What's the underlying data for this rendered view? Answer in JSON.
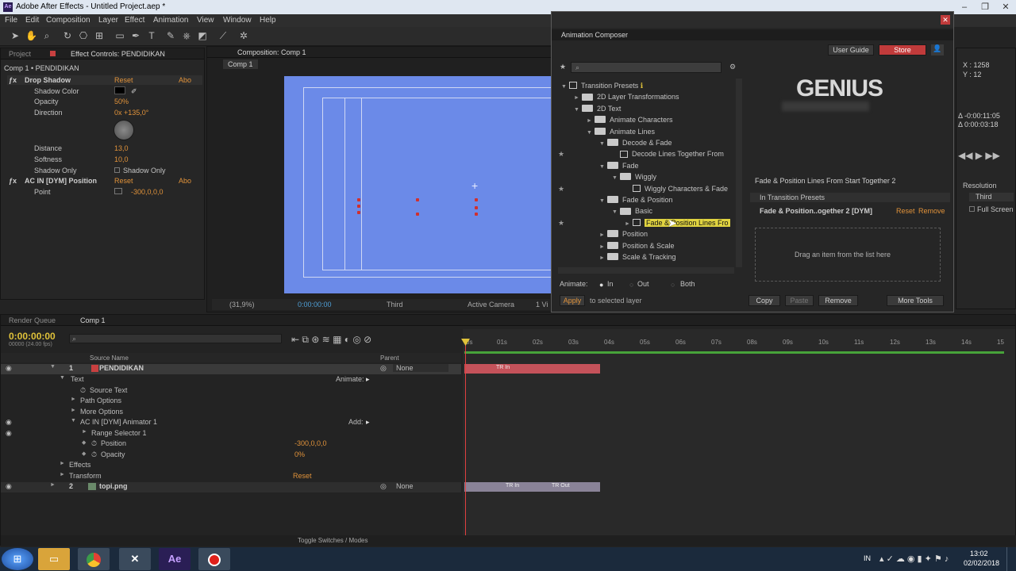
{
  "window": {
    "title": "Adobe After Effects - Untitled Project.aep *",
    "app_icon": "Ae"
  },
  "menu": [
    "File",
    "Edit",
    "Composition",
    "Layer",
    "Effect",
    "Animation",
    "View",
    "Window",
    "Help"
  ],
  "left_panel": {
    "tab_project": "Project",
    "tab_effect": "Effect Controls: PENDIDIKAN",
    "crumb": "Comp 1 • PENDIDIKAN",
    "fx1_name": "Drop Shadow",
    "reset": "Reset",
    "about": "Abo",
    "shadow_color": "Shadow Color",
    "opacity": "Opacity",
    "opacity_val": "50%",
    "direction": "Direction",
    "direction_val": "0x +135,0°",
    "distance": "Distance",
    "distance_val": "13,0",
    "softness": "Softness",
    "softness_val": "10,0",
    "shadow_only": "Shadow Only",
    "shadow_only_cb": "Shadow Only",
    "fx2_name": "AC IN [DYM] Position",
    "point": "Point",
    "point_val": "-300,0,0,0"
  },
  "comp_panel": {
    "tab": "Composition: Comp 1",
    "sub_tab": "Comp 1",
    "zoom": "(31,9%)",
    "timecode": "0:00:00:00",
    "view": "Third",
    "camera": "Active Camera",
    "views": "1 Vi"
  },
  "animation_composer": {
    "tab": "Animation Composer",
    "user_guide": "User Guide",
    "store": "Store",
    "logo": "GENIUS",
    "tree": [
      {
        "label": "Transition Presets",
        "depth": 0,
        "type": "root",
        "star": false
      },
      {
        "label": "2D Layer Transformations",
        "depth": 1,
        "type": "folder",
        "arrow": "►",
        "star": false
      },
      {
        "label": "2D Text",
        "depth": 1,
        "type": "folder",
        "arrow": "▼",
        "star": false
      },
      {
        "label": "Animate Characters",
        "depth": 2,
        "type": "folder",
        "arrow": "►",
        "star": false
      },
      {
        "label": "Animate Lines",
        "depth": 2,
        "type": "folder",
        "arrow": "▼",
        "star": false
      },
      {
        "label": "Decode & Fade",
        "depth": 3,
        "type": "folder",
        "arrow": "▼",
        "star": false
      },
      {
        "label": "Decode Lines Together From",
        "depth": 4,
        "type": "file",
        "arrow": "",
        "star": true
      },
      {
        "label": "Fade",
        "depth": 3,
        "type": "folder",
        "arrow": "▼",
        "star": false
      },
      {
        "label": "Wiggly",
        "depth": 4,
        "type": "folder",
        "arrow": "▼",
        "star": false
      },
      {
        "label": "Wiggly Characters & Fade",
        "depth": 5,
        "type": "file",
        "arrow": "",
        "star": true
      },
      {
        "label": "Fade & Position",
        "depth": 3,
        "type": "folder",
        "arrow": "▼",
        "star": false
      },
      {
        "label": "Basic",
        "depth": 4,
        "type": "folder",
        "arrow": "▼",
        "star": false
      },
      {
        "label": "Fade & Position Lines Fro",
        "depth": 5,
        "type": "file",
        "arrow": "►",
        "star": true,
        "selected": true
      },
      {
        "label": "Position",
        "depth": 3,
        "type": "folder",
        "arrow": "►",
        "star": false
      },
      {
        "label": "Position & Scale",
        "depth": 3,
        "type": "folder",
        "arrow": "►",
        "star": false
      },
      {
        "label": "Scale & Tracking",
        "depth": 3,
        "type": "folder",
        "arrow": "►",
        "star": false
      }
    ],
    "animate_label": "Animate:",
    "opt_in": "In",
    "opt_out": "Out",
    "opt_both": "Both",
    "apply": "Apply",
    "apply_hint": "to selected layer",
    "preset_title": "Fade & Position Lines From Start Together 2",
    "in_transition": "In Transition Presets",
    "applied_item": "Fade & Position..ogether 2 [DYM]",
    "reset": "Reset",
    "remove": "Remove",
    "drop_hint": "Drag an item from the list here",
    "copy": "Copy",
    "paste": "Paste",
    "remove_dd": "Remove",
    "more_tools": "More Tools"
  },
  "info_panel": {
    "x": "X : 1258",
    "y": "Y : 12",
    "t1": "Δ -0:00:11:05",
    "t2": "Δ 0:00:03:18",
    "resolution": "Resolution",
    "third": "Third",
    "full_screen": "Full Screen"
  },
  "timeline": {
    "tab_render": "Render Queue",
    "tab_comp": "Comp 1",
    "timecode": "0:00:00:00",
    "fps": "00000 (24.00 fps)",
    "col_source": "Source Name",
    "col_parent": "Parent",
    "ruler": [
      "0s",
      "01s",
      "02s",
      "03s",
      "04s",
      "05s",
      "06s",
      "07s",
      "08s",
      "09s",
      "10s",
      "11s",
      "12s",
      "13s",
      "14s",
      "15"
    ],
    "layer1_num": "1",
    "layer1_name": "PENDIDIKAN",
    "parent_none": "None",
    "text": "Text",
    "animate": "Animate:",
    "source_text": "Source Text",
    "path_options": "Path Options",
    "more_options": "More Options",
    "animator": "AC IN [DYM] Animator 1",
    "add": "Add:",
    "range_selector": "Range Selector 1",
    "position": "Position",
    "position_val": "-300,0,0,0",
    "opacity": "Opacity",
    "opacity_val": "0%",
    "effects": "Effects",
    "transform": "Transform",
    "reset": "Reset",
    "layer2_num": "2",
    "layer2_name": "topi.png",
    "bar_tr_in": "TR In",
    "bar_tr_in2": "TR In",
    "bar_tr_out": "TR Out",
    "toggle": "Toggle Switches / Modes"
  },
  "taskbar": {
    "lang": "IN",
    "time": "13:02",
    "date": "02/02/2018"
  },
  "colors": {
    "comp_bg": "#6b8ae8",
    "accent_red": "#d04848",
    "store": "#c13b3b",
    "layer1_bar": "#c4525a",
    "layer2_bar": "#8a8398"
  }
}
